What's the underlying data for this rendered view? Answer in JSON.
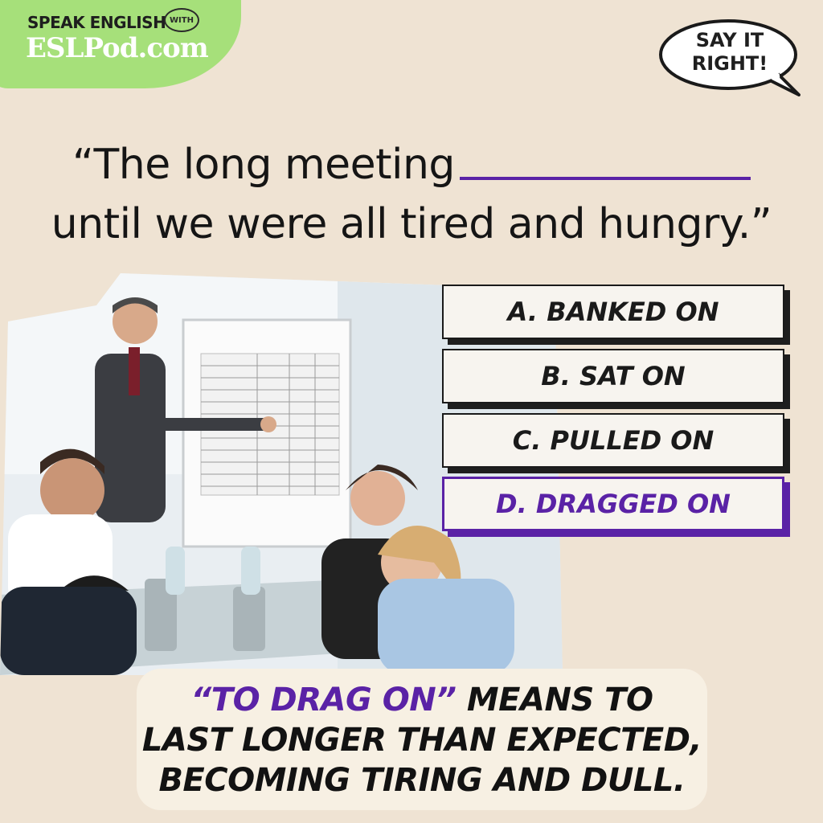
{
  "logo": {
    "line1": "SPEAK ENGLISH",
    "with": "WITH",
    "main": "ESLPod.com"
  },
  "badge": {
    "line1": "SAY IT",
    "line2": "RIGHT!"
  },
  "question": {
    "line1": "“The long meeting",
    "line2": "until we were all tired and hungry.”"
  },
  "options": [
    {
      "label": "A. BANKED ON",
      "correct": false
    },
    {
      "label": "B. SAT ON",
      "correct": false
    },
    {
      "label": "C. PULLED ON",
      "correct": false
    },
    {
      "label": "D. DRAGGED ON",
      "correct": true
    }
  ],
  "explanation": {
    "highlight": "“TO DRAG ON”",
    "rest1": " MEANS TO",
    "line2": "LAST LONGER THAN EXPECTED,",
    "line3": "BECOMING TIRING AND DULL."
  },
  "colors": {
    "accent": "#5a22a6",
    "logo_green": "#a6e07a",
    "background": "#efe3d3"
  },
  "photo": {
    "subject": "business meeting with bored, tired attendees"
  }
}
